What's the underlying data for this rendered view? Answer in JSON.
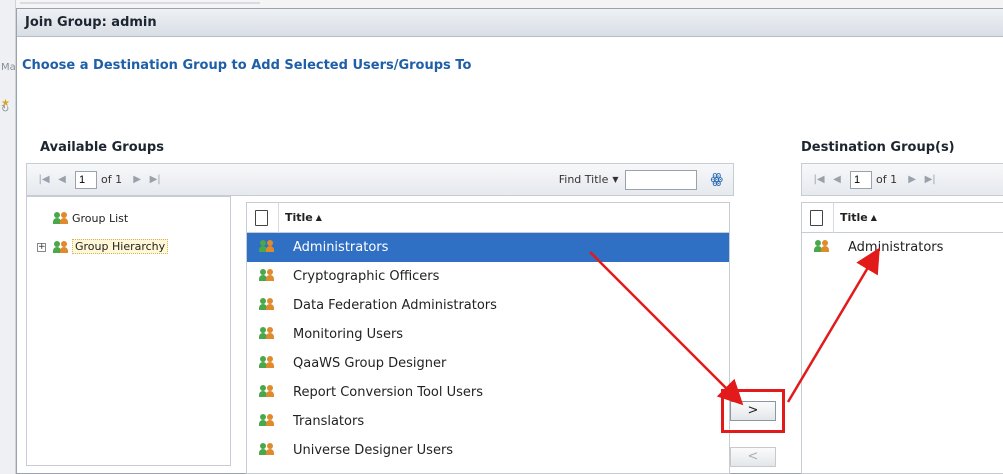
{
  "dialog": {
    "title": "Join Group: admin",
    "heading": "Choose a Destination Group to Add Selected Users/Groups To"
  },
  "available": {
    "label": "Available Groups",
    "toolbar": {
      "first": "⏮",
      "prev": "◀",
      "page": "1",
      "of": "of 1",
      "next": "▶",
      "last": "⏭",
      "find_label": "Find Title",
      "find_value": ""
    },
    "tree": [
      {
        "label": "Group List",
        "selected": false
      },
      {
        "label": "Group Hierarchy",
        "selected": true,
        "expander": "+"
      }
    ],
    "column_title": "Title",
    "rows": [
      {
        "title": "Administrators",
        "selected": true
      },
      {
        "title": "Cryptographic Officers"
      },
      {
        "title": "Data Federation Administrators"
      },
      {
        "title": "Monitoring Users"
      },
      {
        "title": "QaaWS Group Designer"
      },
      {
        "title": "Report Conversion Tool Users"
      },
      {
        "title": "Translators"
      },
      {
        "title": "Universe Designer Users"
      }
    ]
  },
  "buttons": {
    "add": ">",
    "remove": "<"
  },
  "destination": {
    "label": "Destination Group(s)",
    "toolbar": {
      "first": "⏮",
      "prev": "◀",
      "page": "1",
      "of": "of 1",
      "next": "▶",
      "last": "⏭"
    },
    "column_title": "Title",
    "rows": [
      {
        "title": "Administrators"
      }
    ]
  },
  "colors": {
    "accent": "#1f5fa8",
    "selection": "#2f6fc4",
    "annotation": "#e21a1a"
  }
}
